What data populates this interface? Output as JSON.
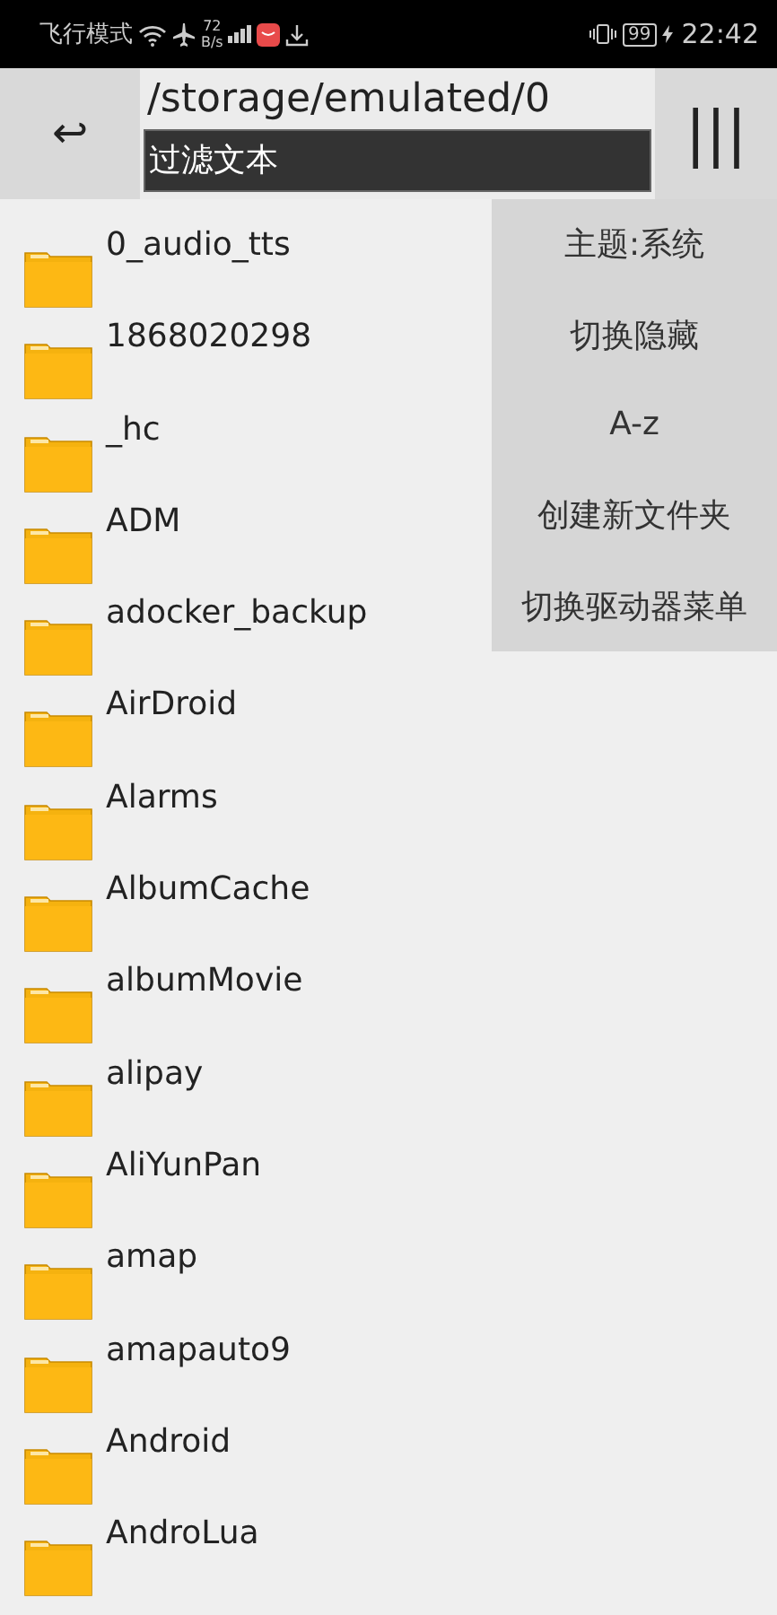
{
  "status_bar": {
    "carrier": "飞行模式",
    "speed_value": "72",
    "speed_unit": "B/s",
    "battery": "99",
    "time": "22:42"
  },
  "header": {
    "back": "↩",
    "path": "/storage/emulated/0",
    "filter": {
      "placeholder": "过滤文本"
    },
    "menu": "|||"
  },
  "folders": [
    {
      "name": "0_audio_tts"
    },
    {
      "name": "1868020298"
    },
    {
      "name": "_hc"
    },
    {
      "name": "ADM"
    },
    {
      "name": "adocker_backup"
    },
    {
      "name": "AirDroid"
    },
    {
      "name": "Alarms"
    },
    {
      "name": "AlbumCache"
    },
    {
      "name": "albumMovie"
    },
    {
      "name": "alipay"
    },
    {
      "name": "AliYunPan"
    },
    {
      "name": "amap"
    },
    {
      "name": "amapauto9"
    },
    {
      "name": "Android"
    },
    {
      "name": "AndroLua"
    }
  ],
  "menu": [
    {
      "label": "主题:系统"
    },
    {
      "label": "切换隐藏"
    },
    {
      "label": "A-z"
    },
    {
      "label": "创建新文件夹"
    },
    {
      "label": "切换驱动器菜单"
    }
  ]
}
